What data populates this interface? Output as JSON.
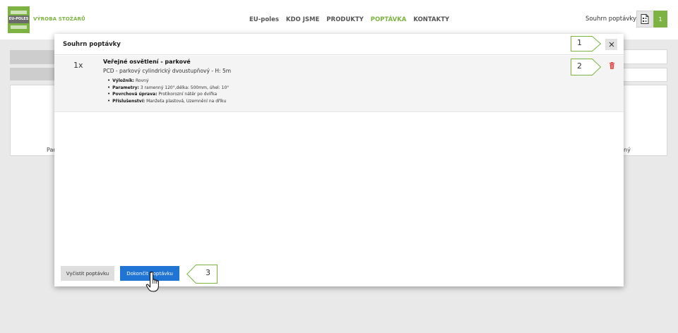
{
  "header": {
    "brand_text": "VÝROBA STOŽÁRŮ",
    "logo_text": "EU-POLES",
    "nav": [
      "EU-poles",
      "KDO JSME",
      "PRODUKTY",
      "POPTÁVKA",
      "KONTAKTY"
    ],
    "active_nav_index": 3,
    "summary_label": "Souhrn poptávky:",
    "summary_count": "1"
  },
  "background": {
    "left_caption": "Par",
    "right_caption": "ný"
  },
  "modal": {
    "title": "Souhrn poptávky",
    "item": {
      "qty": "1x",
      "title": "Veřejné osvětlení - parkové",
      "subtitle": "PCD - parkový cylindrický dvoustupňový - H: 5m",
      "attributes": [
        {
          "label": "Výložník:",
          "value": "Rovný"
        },
        {
          "label": "Parametry:",
          "value": "3 ramenný 120°,délka: 500mm, úhel: 10°"
        },
        {
          "label": "Povrchová úprava:",
          "value": "Protikorozní nátěr po dvířka"
        },
        {
          "label": "Příslušenství:",
          "value": "Manžeta plastová, Uzemnění na dříku"
        }
      ]
    },
    "clear_button": "Vyčistit poptávku",
    "finish_button": "Dokončit poptávku"
  },
  "callouts": [
    "1",
    "2",
    "3"
  ],
  "colors": {
    "accent_green": "#7cb342",
    "primary_blue": "#1f74d4",
    "delete_red": "#e53935"
  }
}
